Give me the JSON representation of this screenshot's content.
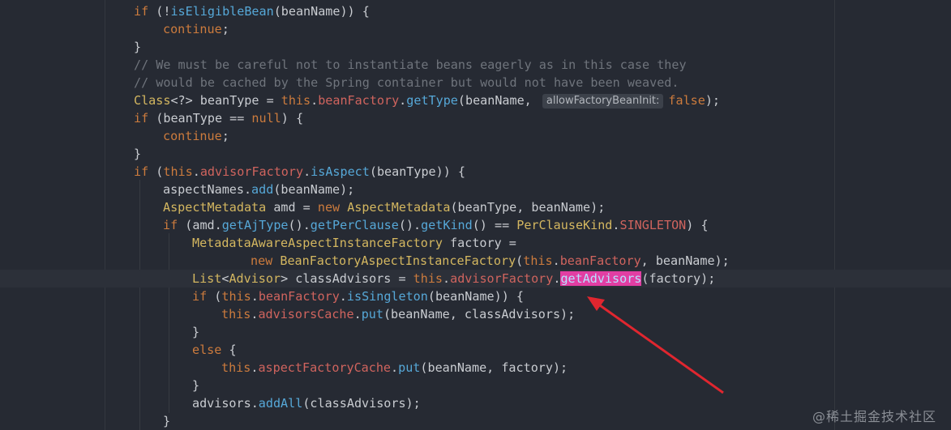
{
  "editor": {
    "language": "java",
    "lines": [
      {
        "indent": 1,
        "tokens": [
          {
            "t": "kw",
            "v": "if"
          },
          {
            "t": "tx",
            "v": " (!"
          },
          {
            "t": "fn",
            "v": "isEligibleBean"
          },
          {
            "t": "tx",
            "v": "(beanName)) {"
          }
        ]
      },
      {
        "indent": 2,
        "tokens": [
          {
            "t": "kw",
            "v": "continue"
          },
          {
            "t": "tx",
            "v": ";"
          }
        ]
      },
      {
        "indent": 1,
        "tokens": [
          {
            "t": "tx",
            "v": "}"
          }
        ]
      },
      {
        "indent": 1,
        "tokens": [
          {
            "t": "cm",
            "v": "// We must be careful not to instantiate beans eagerly as in this case they"
          }
        ]
      },
      {
        "indent": 1,
        "tokens": [
          {
            "t": "cm",
            "v": "// would be cached by the Spring container but would not have been weaved."
          }
        ]
      },
      {
        "indent": 1,
        "tokens": [
          {
            "t": "cls",
            "v": "Class"
          },
          {
            "t": "tx",
            "v": "<?> beanType = "
          },
          {
            "t": "kw",
            "v": "this"
          },
          {
            "t": "tx",
            "v": "."
          },
          {
            "t": "field",
            "v": "beanFactory"
          },
          {
            "t": "tx",
            "v": "."
          },
          {
            "t": "fn",
            "v": "getType"
          },
          {
            "t": "tx",
            "v": "(beanName, "
          },
          {
            "t": "hint",
            "v": "allowFactoryBeanInit:"
          },
          {
            "t": "kw",
            "v": "false"
          },
          {
            "t": "tx",
            "v": ");"
          }
        ]
      },
      {
        "indent": 1,
        "tokens": [
          {
            "t": "kw",
            "v": "if"
          },
          {
            "t": "tx",
            "v": " (beanType == "
          },
          {
            "t": "kw",
            "v": "null"
          },
          {
            "t": "tx",
            "v": ") {"
          }
        ]
      },
      {
        "indent": 2,
        "tokens": [
          {
            "t": "kw",
            "v": "continue"
          },
          {
            "t": "tx",
            "v": ";"
          }
        ]
      },
      {
        "indent": 1,
        "tokens": [
          {
            "t": "tx",
            "v": "}"
          }
        ]
      },
      {
        "indent": 1,
        "tokens": [
          {
            "t": "kw",
            "v": "if"
          },
          {
            "t": "tx",
            "v": " ("
          },
          {
            "t": "kw",
            "v": "this"
          },
          {
            "t": "tx",
            "v": "."
          },
          {
            "t": "field",
            "v": "advisorFactory"
          },
          {
            "t": "tx",
            "v": "."
          },
          {
            "t": "fn",
            "v": "isAspect"
          },
          {
            "t": "tx",
            "v": "(beanType)) {"
          }
        ]
      },
      {
        "indent": 2,
        "tokens": [
          {
            "t": "tx",
            "v": "aspectNames."
          },
          {
            "t": "fn",
            "v": "add"
          },
          {
            "t": "tx",
            "v": "(beanName);"
          }
        ]
      },
      {
        "indent": 2,
        "tokens": [
          {
            "t": "cls",
            "v": "AspectMetadata"
          },
          {
            "t": "tx",
            "v": " amd = "
          },
          {
            "t": "kw",
            "v": "new"
          },
          {
            "t": "tx",
            "v": " "
          },
          {
            "t": "cls",
            "v": "AspectMetadata"
          },
          {
            "t": "tx",
            "v": "(beanType, beanName);"
          }
        ]
      },
      {
        "indent": 2,
        "tokens": [
          {
            "t": "kw",
            "v": "if"
          },
          {
            "t": "tx",
            "v": " (amd."
          },
          {
            "t": "fn",
            "v": "getAjType"
          },
          {
            "t": "tx",
            "v": "()."
          },
          {
            "t": "fn",
            "v": "getPerClause"
          },
          {
            "t": "tx",
            "v": "()."
          },
          {
            "t": "fn",
            "v": "getKind"
          },
          {
            "t": "tx",
            "v": "() == "
          },
          {
            "t": "cls",
            "v": "PerClauseKind"
          },
          {
            "t": "tx",
            "v": "."
          },
          {
            "t": "field",
            "v": "SINGLETON"
          },
          {
            "t": "tx",
            "v": ") {"
          }
        ]
      },
      {
        "indent": 3,
        "tokens": [
          {
            "t": "cls",
            "v": "MetadataAwareAspectInstanceFactory"
          },
          {
            "t": "tx",
            "v": " factory ="
          }
        ]
      },
      {
        "indent": 5,
        "tokens": [
          {
            "t": "kw",
            "v": "new"
          },
          {
            "t": "tx",
            "v": " "
          },
          {
            "t": "cls",
            "v": "BeanFactoryAspectInstanceFactory"
          },
          {
            "t": "tx",
            "v": "("
          },
          {
            "t": "kw",
            "v": "this"
          },
          {
            "t": "tx",
            "v": "."
          },
          {
            "t": "field",
            "v": "beanFactory"
          },
          {
            "t": "tx",
            "v": ", beanName);"
          }
        ]
      },
      {
        "indent": 3,
        "current": true,
        "tokens": [
          {
            "t": "cls",
            "v": "List"
          },
          {
            "t": "tx",
            "v": "<"
          },
          {
            "t": "cls",
            "v": "Advisor"
          },
          {
            "t": "tx",
            "v": "> classAdvisors = "
          },
          {
            "t": "kw",
            "v": "this"
          },
          {
            "t": "tx",
            "v": "."
          },
          {
            "t": "field",
            "v": "advisorFactory"
          },
          {
            "t": "tx",
            "v": "."
          },
          {
            "t": "hl",
            "v": "getAdvisors"
          },
          {
            "t": "tx",
            "v": "(factory);"
          }
        ]
      },
      {
        "indent": 3,
        "tokens": [
          {
            "t": "kw",
            "v": "if"
          },
          {
            "t": "tx",
            "v": " ("
          },
          {
            "t": "kw",
            "v": "this"
          },
          {
            "t": "tx",
            "v": "."
          },
          {
            "t": "field",
            "v": "beanFactory"
          },
          {
            "t": "tx",
            "v": "."
          },
          {
            "t": "fn",
            "v": "isSingleton"
          },
          {
            "t": "tx",
            "v": "(beanName)) {"
          }
        ]
      },
      {
        "indent": 4,
        "tokens": [
          {
            "t": "kw",
            "v": "this"
          },
          {
            "t": "tx",
            "v": "."
          },
          {
            "t": "field",
            "v": "advisorsCache"
          },
          {
            "t": "tx",
            "v": "."
          },
          {
            "t": "fn",
            "v": "put"
          },
          {
            "t": "tx",
            "v": "(beanName, classAdvisors);"
          }
        ]
      },
      {
        "indent": 3,
        "tokens": [
          {
            "t": "tx",
            "v": "}"
          }
        ]
      },
      {
        "indent": 3,
        "tokens": [
          {
            "t": "kw",
            "v": "else"
          },
          {
            "t": "tx",
            "v": " {"
          }
        ]
      },
      {
        "indent": 4,
        "tokens": [
          {
            "t": "kw",
            "v": "this"
          },
          {
            "t": "tx",
            "v": "."
          },
          {
            "t": "field",
            "v": "aspectFactoryCache"
          },
          {
            "t": "tx",
            "v": "."
          },
          {
            "t": "fn",
            "v": "put"
          },
          {
            "t": "tx",
            "v": "(beanName, factory);"
          }
        ]
      },
      {
        "indent": 3,
        "tokens": [
          {
            "t": "tx",
            "v": "}"
          }
        ]
      },
      {
        "indent": 3,
        "tokens": [
          {
            "t": "tx",
            "v": "advisors."
          },
          {
            "t": "fn",
            "v": "addAll"
          },
          {
            "t": "tx",
            "v": "(classAdvisors);"
          }
        ]
      },
      {
        "indent": 2,
        "tokens": [
          {
            "t": "tx",
            "v": "}"
          }
        ]
      }
    ]
  },
  "annotation": {
    "type": "arrow",
    "color": "#e0262f",
    "points_to": "getAdvisors"
  },
  "watermark": "@稀土掘金技术社区",
  "colors": {
    "background": "#262a33",
    "keyword": "#cc7b3d",
    "method": "#56a8d8",
    "field": "#d0645e",
    "class": "#d4b760",
    "comment": "#6f747c",
    "text": "#c9ccd1",
    "highlight": "#e23ea3",
    "arrow": "#e0262f"
  }
}
